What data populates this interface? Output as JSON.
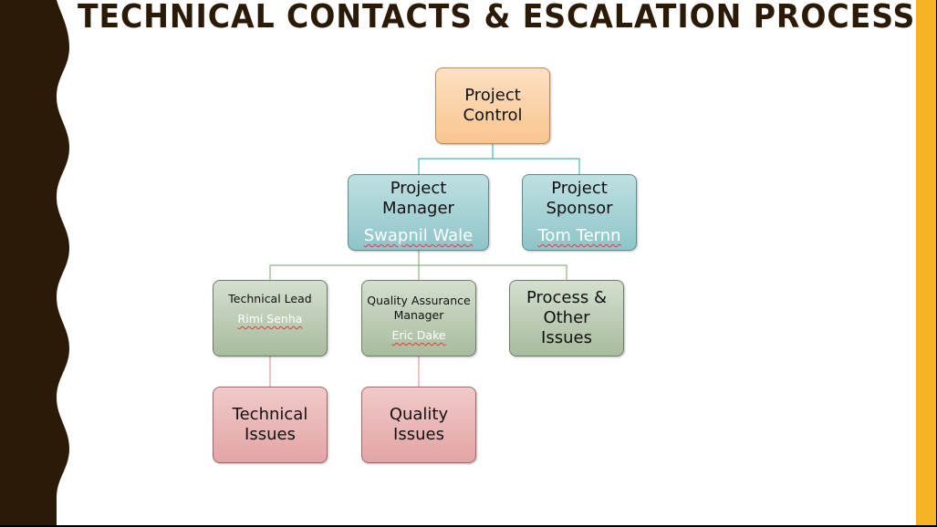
{
  "slide": {
    "title": "TECHNICAL CONTACTS & ESCALATION PROCESS",
    "colors": {
      "title": "#2b1a06",
      "left_wave": "#2b1a06",
      "right_bar": "#f7b324",
      "level1_fill": "#f9c58e",
      "level2_fill": "#8ec5c8",
      "level3_fill": "#a8bc9e",
      "level4_fill": "#e3a4a4",
      "teal_connector": "#4fb3b8",
      "green_connector": "#8fb17e",
      "pink_connector": "#e39a9a"
    }
  },
  "org_chart": {
    "project_control": {
      "label_line1": "Project",
      "label_line2": "Control"
    },
    "project_manager": {
      "label_line1": "Project",
      "label_line2": "Manager",
      "person": "Swapnil Wale"
    },
    "project_sponsor": {
      "label_line1": "Project",
      "label_line2": "Sponsor",
      "person": "Tom Ternn"
    },
    "technical_lead": {
      "label": "Technical Lead",
      "person": "Rimi Senha"
    },
    "qa_manager": {
      "label_line1": "Quality Assurance",
      "label_line2": "Manager",
      "person": "Eric Dake"
    },
    "process_other": {
      "label_line1": "Process &",
      "label_line2": "Other",
      "label_line3": "Issues"
    },
    "technical_issues": {
      "label_line1": "Technical",
      "label_line2": "Issues"
    },
    "quality_issues": {
      "label_line1": "Quality",
      "label_line2": "Issues"
    },
    "edges": [
      [
        "project_control",
        "project_manager"
      ],
      [
        "project_control",
        "project_sponsor"
      ],
      [
        "project_manager",
        "technical_lead"
      ],
      [
        "project_manager",
        "qa_manager"
      ],
      [
        "project_manager",
        "process_other"
      ],
      [
        "technical_lead",
        "technical_issues"
      ],
      [
        "qa_manager",
        "quality_issues"
      ]
    ]
  }
}
